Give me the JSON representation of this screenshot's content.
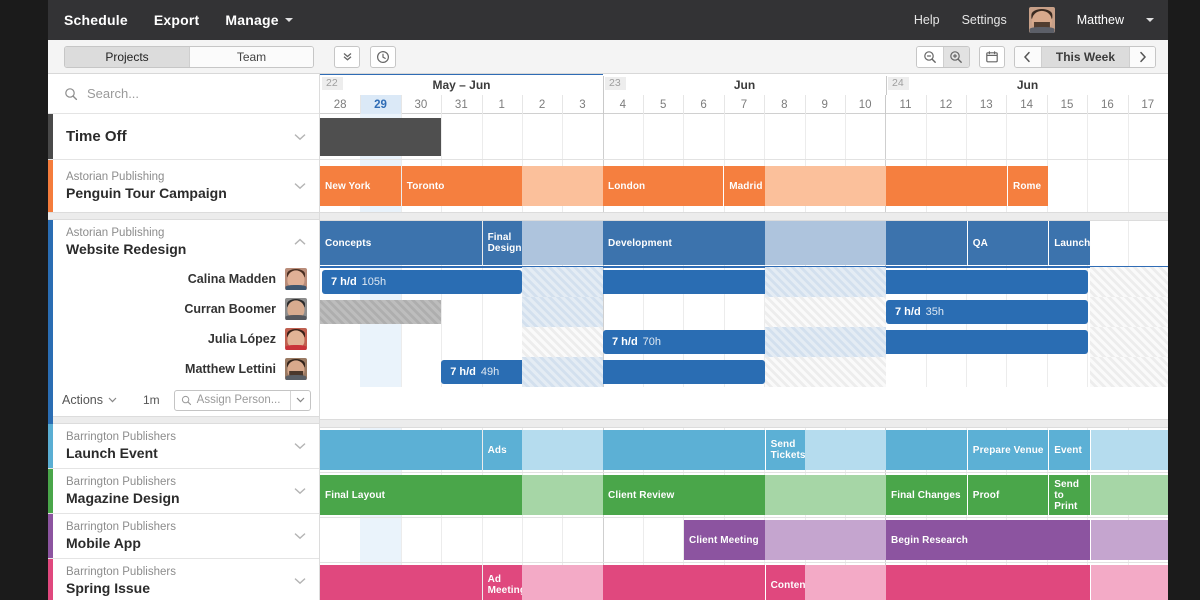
{
  "topnav": {
    "items": [
      {
        "label": "Schedule",
        "icon": null
      },
      {
        "label": "Export",
        "icon": null
      },
      {
        "label": "Manage",
        "icon": "chevron-down-icon"
      }
    ],
    "help_label": "Help",
    "settings_label": "Settings",
    "user_name": "Matthew",
    "user_caret": "chevron-down-icon",
    "background": "#333335"
  },
  "toolbar": {
    "tabs": [
      {
        "label": "Projects",
        "active": true
      },
      {
        "label": "Team",
        "active": false
      }
    ],
    "collapse_icon": "double-chevron-down-icon",
    "clock_icon": "clock-icon",
    "zoom_out_icon": "zoom-out-icon",
    "zoom_in_icon": "zoom-in-icon",
    "calendar_icon": "calendar-icon",
    "prev_icon": "chevron-left-icon",
    "next_icon": "chevron-right-icon",
    "range_label": "This Week"
  },
  "search": {
    "icon": "search-icon",
    "placeholder": "Search..."
  },
  "timeline": {
    "weeks": [
      {
        "number": "22",
        "month_label": "May – Jun"
      },
      {
        "number": "23",
        "month_label": "Jun"
      },
      {
        "number": "24",
        "month_label": "Jun"
      }
    ],
    "days": [
      "28",
      "29",
      "30",
      "31",
      "1",
      "2",
      "3",
      "4",
      "5",
      "6",
      "7",
      "8",
      "9",
      "10",
      "11",
      "12",
      "13",
      "14",
      "15",
      "16",
      "17"
    ],
    "today_index": 1,
    "today_label": "29"
  },
  "accent_colors": {
    "time_off": "#4a4a4a",
    "penguin": "#f47c3c",
    "website": "#2a6db3",
    "launch": "#5aaed3",
    "magazine": "#49a council",
    "mobile": "#8c54a0",
    "spring": "#e0487e"
  },
  "rows": [
    {
      "id": "time-off",
      "client": null,
      "name": "Time Off",
      "accent": "#4a4a4a",
      "chevron": "chevron-down-icon",
      "expanded": false
    },
    {
      "id": "penguin-tour-campaign",
      "client": "Astorian Publishing",
      "name": "Penguin Tour Campaign",
      "accent": "#f47c3c",
      "chevron": "chevron-down-icon",
      "expanded": false
    },
    {
      "id": "website-redesign",
      "client": "Astorian Publishing",
      "name": "Website Redesign",
      "accent": "#2a6db3",
      "chevron": "chevron-up-icon",
      "expanded": true,
      "people": [
        {
          "name": "Calina Madden",
          "avatar": "avatar-calina"
        },
        {
          "name": "Curran Boomer",
          "avatar": "avatar-curran"
        },
        {
          "name": "Julia López",
          "avatar": "avatar-julia"
        },
        {
          "name": "Matthew Lettini",
          "avatar": "avatar-matthew"
        }
      ],
      "footer": {
        "actions_label": "Actions",
        "actions_caret": "chevron-down-icon",
        "duration": "1m",
        "assign_placeholder": "Assign Person...",
        "assign_icon": "search-icon",
        "assign_caret": "chevron-down-icon"
      }
    },
    {
      "id": "launch-event",
      "client": "Barrington Publishers",
      "name": "Launch Event",
      "accent": "#5aaed3",
      "chevron": "chevron-down-icon",
      "expanded": false
    },
    {
      "id": "magazine-design",
      "client": "Barrington Publishers",
      "name": "Magazine Design",
      "accent": "#4aa64a",
      "chevron": "chevron-down-icon",
      "expanded": false
    },
    {
      "id": "mobile-app",
      "client": "Barrington Publishers",
      "name": "Mobile App",
      "accent": "#8c54a0",
      "chevron": "chevron-down-icon",
      "expanded": false
    },
    {
      "id": "spring-issue",
      "client": "Barrington Publishers",
      "name": "Spring Issue",
      "accent": "#e0487e",
      "chevron": "chevron-down-icon",
      "expanded": false
    }
  ],
  "bars": {
    "time_off": [
      {
        "label": "",
        "start": 0,
        "span": 3,
        "color": "#4f4f4f"
      }
    ],
    "penguin": [
      {
        "label": "New York",
        "start": 0,
        "span": 2,
        "color": "#f57f3f"
      },
      {
        "label": "Toronto",
        "start": 2,
        "span": 3,
        "color": "#f57f3f"
      },
      {
        "label": "",
        "start": 5,
        "span": 2,
        "color": "#fbc09b"
      },
      {
        "label": "London",
        "start": 7,
        "span": 3,
        "color": "#f57f3f"
      },
      {
        "label": "Madrid",
        "start": 10,
        "span": 1,
        "color": "#f57f3f"
      },
      {
        "label": "",
        "start": 11,
        "span": 3,
        "color": "#fbc09b"
      },
      {
        "label": "",
        "start": 14,
        "span": 3,
        "color": "#f57f3f"
      },
      {
        "label": "Rome",
        "start": 17,
        "span": 1,
        "color": "#f57f3f"
      }
    ],
    "website_phases": [
      {
        "label": "Concepts",
        "start": 0,
        "span": 4,
        "color": "#3c73ad"
      },
      {
        "label": "Final Design",
        "start": 4,
        "span": 1,
        "color": "#3c73ad"
      },
      {
        "label": "",
        "start": 5,
        "span": 2,
        "color": "#aec4dd"
      },
      {
        "label": "Development",
        "start": 7,
        "span": 4,
        "color": "#3c73ad"
      },
      {
        "label": "",
        "start": 11,
        "span": 3,
        "color": "#aec4dd"
      },
      {
        "label": "",
        "start": 14,
        "span": 2,
        "color": "#3c73ad"
      },
      {
        "label": "QA",
        "start": 16,
        "span": 2,
        "color": "#3c73ad"
      },
      {
        "label": "Launch",
        "start": 18,
        "span": 1,
        "color": "#3c73ad"
      }
    ],
    "allocations": [
      {
        "person": "Calina Madden",
        "rate": "7 h/d",
        "hours": "105h",
        "start": 0,
        "span": 19,
        "gaps": [
          [
            5,
            2
          ],
          [
            11,
            3
          ]
        ]
      },
      {
        "person": "Curran Boomer",
        "rate": "7 h/d",
        "hours": "35h",
        "start": 14,
        "span": 5,
        "gaps": []
      },
      {
        "person": "Julia López",
        "rate": "7 h/d",
        "hours": "70h",
        "start": 7,
        "span": 12,
        "gaps": [
          [
            11,
            3
          ]
        ]
      },
      {
        "person": "Matthew Lettini",
        "rate": "7 h/d",
        "hours": "49h",
        "start": 3,
        "span": 8,
        "gaps": [
          [
            5,
            2
          ]
        ]
      }
    ],
    "launch_event": [
      {
        "label": "",
        "start": 0,
        "span": 4,
        "color": "#5cb0d5"
      },
      {
        "label": "Ads",
        "start": 4,
        "span": 1,
        "color": "#5cb0d5"
      },
      {
        "label": "",
        "start": 5,
        "span": 2,
        "color": "#b5dcee"
      },
      {
        "label": "",
        "start": 7,
        "span": 4,
        "color": "#5cb0d5"
      },
      {
        "label": "Send Tickets",
        "start": 11,
        "span": 1,
        "color": "#5cb0d5"
      },
      {
        "label": "",
        "start": 12,
        "span": 2,
        "color": "#b5dcee"
      },
      {
        "label": "",
        "start": 14,
        "span": 2,
        "color": "#5cb0d5"
      },
      {
        "label": "Prepare Venue",
        "start": 16,
        "span": 2,
        "color": "#5cb0d5"
      },
      {
        "label": "Event",
        "start": 18,
        "span": 1,
        "color": "#5cb0d5"
      },
      {
        "label": "",
        "start": 19,
        "span": 2,
        "color": "#b5dcee"
      }
    ],
    "magazine_design": [
      {
        "label": "Final Layout",
        "start": 0,
        "span": 5,
        "color": "#4aa64a"
      },
      {
        "label": "",
        "start": 5,
        "span": 2,
        "color": "#a6d6a6"
      },
      {
        "label": "Client Review",
        "start": 7,
        "span": 4,
        "color": "#4aa64a"
      },
      {
        "label": "",
        "start": 11,
        "span": 3,
        "color": "#a6d6a6"
      },
      {
        "label": "Final Changes",
        "start": 14,
        "span": 2,
        "color": "#4aa64a"
      },
      {
        "label": "Proof",
        "start": 16,
        "span": 2,
        "color": "#4aa64a"
      },
      {
        "label": "Send to Print",
        "start": 18,
        "span": 1,
        "color": "#4aa64a"
      },
      {
        "label": "",
        "start": 19,
        "span": 2,
        "color": "#a6d6a6"
      }
    ],
    "mobile_app": [
      {
        "label": "Client Meeting",
        "start": 9,
        "span": 2,
        "color": "#8c54a0"
      },
      {
        "label": "",
        "start": 11,
        "span": 3,
        "color": "#c5a5cf"
      },
      {
        "label": "Begin Research",
        "start": 14,
        "span": 5,
        "color": "#8c54a0"
      },
      {
        "label": "",
        "start": 19,
        "span": 2,
        "color": "#c5a5cf"
      }
    ],
    "spring_issue": [
      {
        "label": "",
        "start": 0,
        "span": 4,
        "color": "#e0487e"
      },
      {
        "label": "Ad Meeting",
        "start": 4,
        "span": 1,
        "color": "#e0487e"
      },
      {
        "label": "",
        "start": 5,
        "span": 2,
        "color": "#f3aac6"
      },
      {
        "label": "",
        "start": 7,
        "span": 4,
        "color": "#e0487e"
      },
      {
        "label": "Content",
        "start": 11,
        "span": 1,
        "color": "#e0487e"
      },
      {
        "label": "",
        "start": 12,
        "span": 2,
        "color": "#f3aac6"
      },
      {
        "label": "",
        "start": 14,
        "span": 5,
        "color": "#e0487e"
      },
      {
        "label": "",
        "start": 19,
        "span": 2,
        "color": "#f3aac6"
      }
    ]
  }
}
